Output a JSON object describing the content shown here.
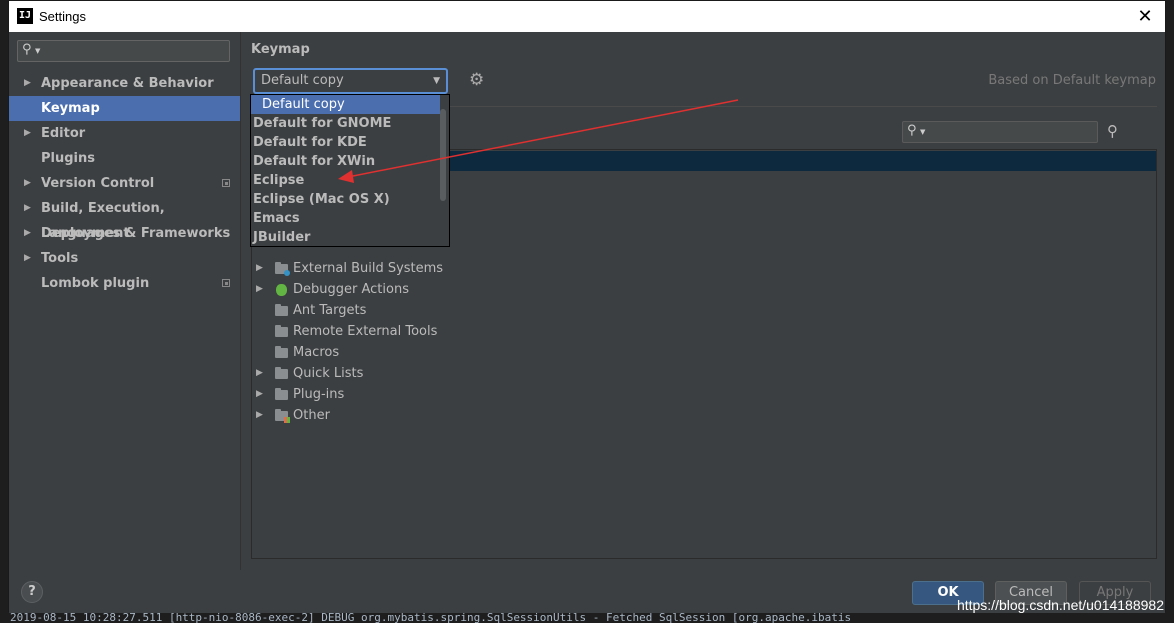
{
  "window": {
    "title": "Settings",
    "app_icon": "IJ"
  },
  "sidebar": {
    "search_placeholder": "",
    "items": [
      {
        "label": "Appearance & Behavior",
        "expandable": true
      },
      {
        "label": "Keymap",
        "selected": true
      },
      {
        "label": "Editor",
        "expandable": true
      },
      {
        "label": "Plugins"
      },
      {
        "label": "Version Control",
        "expandable": true,
        "project_icon": true
      },
      {
        "label": "Build, Execution, Deployment",
        "expandable": true
      },
      {
        "label": "Languages & Frameworks",
        "expandable": true
      },
      {
        "label": "Tools",
        "expandable": true
      },
      {
        "label": "Lombok plugin",
        "project_icon": true
      }
    ]
  },
  "main": {
    "heading": "Keymap",
    "keymap_combo": {
      "value": "Default copy"
    },
    "based_on": "Based on Default keymap",
    "dropdown_options": [
      "Default copy",
      "Default for GNOME",
      "Default for KDE",
      "Default for XWin",
      "Eclipse",
      "Eclipse (Mac OS X)",
      "Emacs",
      "JBuilder"
    ],
    "tree_items": [
      {
        "label": "External Build Systems",
        "expandable": true,
        "icon": "folder-gear-icon"
      },
      {
        "label": "Debugger Actions",
        "expandable": true,
        "icon": "bug-icon"
      },
      {
        "label": "Ant Targets",
        "expandable": false,
        "icon": "folder-icon"
      },
      {
        "label": "Remote External Tools",
        "expandable": false,
        "icon": "folder-icon"
      },
      {
        "label": "Macros",
        "expandable": false,
        "icon": "folder-icon"
      },
      {
        "label": "Quick Lists",
        "expandable": true,
        "icon": "folder-icon"
      },
      {
        "label": "Plug-ins",
        "expandable": true,
        "icon": "folder-icon"
      },
      {
        "label": "Other",
        "expandable": true,
        "icon": "folder-multi-icon"
      }
    ]
  },
  "footer": {
    "ok": "OK",
    "cancel": "Cancel",
    "apply": "Apply",
    "help": "?"
  },
  "background": {
    "console_line": "2019-08-15 10:28:27.511 [http-nio-8086-exec-2] DEBUG org.mybatis.spring.SqlSessionUtils - Fetched SqlSession [org.apache.ibatis"
  },
  "watermark": "https://blog.csdn.net/u014188982",
  "annotation": {
    "arrow_color": "#e03030"
  }
}
